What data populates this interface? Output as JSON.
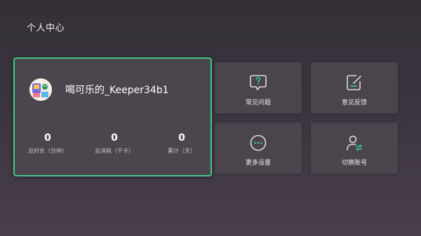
{
  "page": {
    "title": "个人中心"
  },
  "profile": {
    "username": "喝可乐的_Keeper34b1",
    "stats": [
      {
        "value": "0",
        "label": "总时长（分钟）"
      },
      {
        "value": "0",
        "label": "总消耗（千卡）"
      },
      {
        "value": "0",
        "label": "累计（天）"
      }
    ]
  },
  "tiles": [
    {
      "label": "常见问题",
      "icon": "question-icon"
    },
    {
      "label": "意见反馈",
      "icon": "feedback-edit-icon"
    },
    {
      "label": "更多设置",
      "icon": "more-dots-icon"
    },
    {
      "label": "切换账号",
      "icon": "switch-account-icon"
    }
  ],
  "colors": {
    "accent": "#3ec98b",
    "card_bg": "#4b464e",
    "page_bg": "#3b3540"
  }
}
